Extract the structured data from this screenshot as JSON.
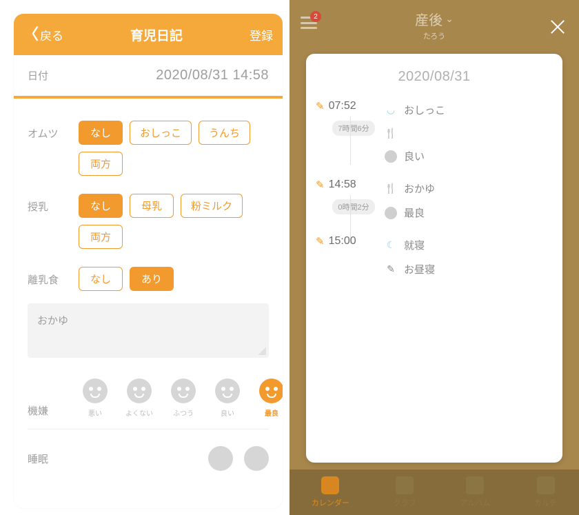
{
  "left": {
    "header": {
      "back": "戻る",
      "title": "育児日記",
      "register": "登録"
    },
    "date": {
      "label": "日付",
      "value": "2020/08/31 14:58"
    },
    "diaper": {
      "label": "オムツ",
      "options": [
        "なし",
        "おしっこ",
        "うんち",
        "両方"
      ],
      "selected": "なし"
    },
    "nursing": {
      "label": "授乳",
      "options": [
        "なし",
        "母乳",
        "粉ミルク",
        "両方"
      ],
      "selected": "なし"
    },
    "weaning": {
      "label": "離乳食",
      "options": [
        "なし",
        "あり"
      ],
      "selected": "あり"
    },
    "note": "おかゆ",
    "mood": {
      "label": "機嫌",
      "options": [
        "悪い",
        "よくない",
        "ふつう",
        "良い",
        "最良"
      ],
      "selected": "最良"
    },
    "sleep": {
      "label": "睡眠"
    }
  },
  "right": {
    "topbar": {
      "title": "産後",
      "subtitle": "たろう",
      "badge": "2"
    },
    "date": "2020/08/31",
    "timeline": [
      {
        "time": "07:52",
        "gap_after": "7時間6分",
        "items": [
          {
            "icon": "diaper",
            "text": "おしっこ"
          },
          {
            "icon": "fork",
            "text": ""
          },
          {
            "icon": "face",
            "text": "良い"
          }
        ]
      },
      {
        "time": "14:58",
        "gap_after": "0時間2分",
        "items": [
          {
            "icon": "fork",
            "text": "おかゆ"
          },
          {
            "icon": "face",
            "text": "最良"
          }
        ]
      },
      {
        "time": "15:00",
        "items": [
          {
            "icon": "moon",
            "text": "就寝"
          },
          {
            "icon": "pencil",
            "text": "お昼寝"
          }
        ]
      }
    ],
    "tabs": [
      {
        "id": "calendar",
        "label": "カレンダー",
        "active": true
      },
      {
        "id": "graph",
        "label": "グラフ"
      },
      {
        "id": "album",
        "label": "アルバム"
      },
      {
        "id": "karte",
        "label": "カルテ"
      }
    ]
  }
}
